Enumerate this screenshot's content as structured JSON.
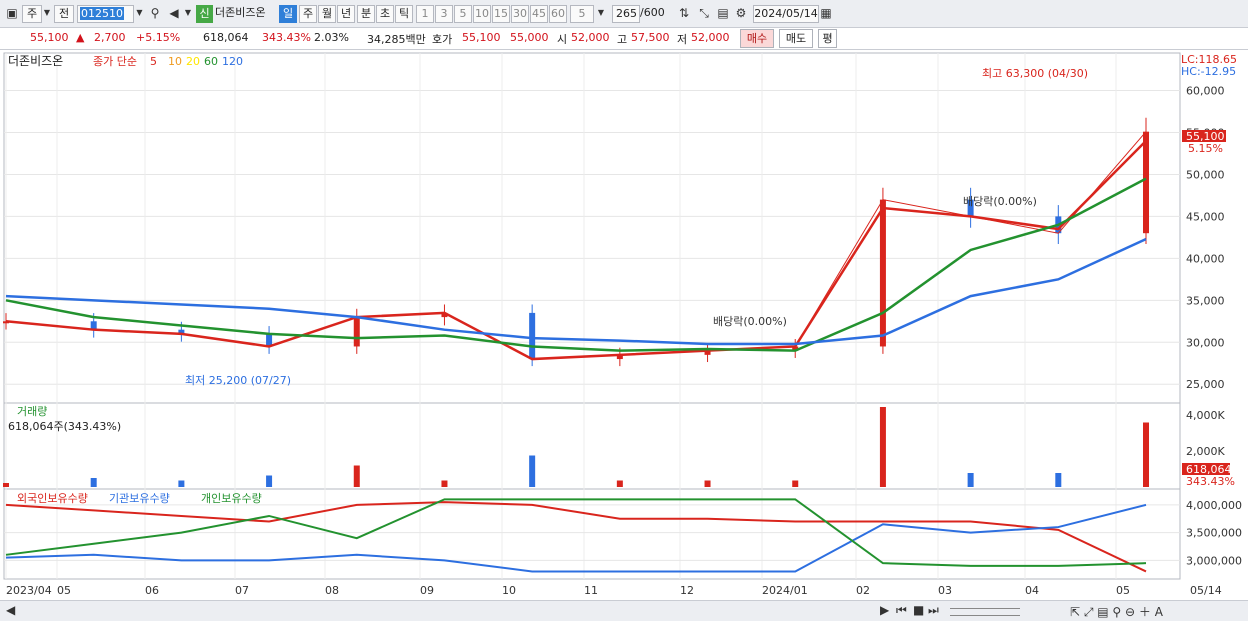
{
  "toolbar": {
    "market": "주",
    "prev": "전",
    "code": "012510",
    "stock_name": "더존비즈온",
    "period_tabs": [
      "일",
      "주",
      "월",
      "년",
      "분",
      "초",
      "틱"
    ],
    "intervals": [
      "1",
      "3",
      "5",
      "10",
      "15",
      "30",
      "45",
      "60"
    ],
    "interval_value": "5",
    "count": "265",
    "count_total": "/600",
    "date": "2024/05/14",
    "prefix_badge": "신"
  },
  "quote": {
    "price": "55,100",
    "change": "2,700",
    "change_pct": "+5.15%",
    "volume": "618,064",
    "vol_ratio": "343.43%",
    "turnover": "2.03%",
    "amount": "34,285백만",
    "bid_label": "호가",
    "ask": "55,100",
    "bid": "55,000",
    "open_label": "시",
    "open": "52,000",
    "high_label": "고",
    "high": "57,500",
    "low_label": "저",
    "low": "52,000",
    "buy": "매수",
    "sell": "매도",
    "eval": "평"
  },
  "price_panel": {
    "name": "더존비즈온",
    "ma_label": "종가 단순",
    "ma_periods": [
      "5",
      "10",
      "20",
      "60",
      "120"
    ],
    "ma_colors": [
      "#d9251d",
      "#ef9a1f",
      "#ffe600",
      "#23922f",
      "#2d6fe0"
    ],
    "lc": "LC:118.65",
    "hc": "HC:-12.95",
    "y_ticks": [
      "60,000",
      "55,000",
      "50,000",
      "45,000",
      "40,000",
      "35,000",
      "30,000",
      "25,000"
    ],
    "last_price": "55,100",
    "last_pct": "5.15%",
    "annot_high": "최고 63,300 (04/30)",
    "annot_low": "최저 25,200 (07/27)",
    "annot_div1": "배당락(0.00%)",
    "annot_div2": "배당락(0.00%)"
  },
  "volume_panel": {
    "title": "거래량",
    "value": "618,064주(343.43%)",
    "y_ticks": [
      "4,000K",
      "2,000K"
    ],
    "last": "618,064",
    "last_pct": "343.43%"
  },
  "holding_panel": {
    "legend": [
      "외국인보유수량",
      "기관보유수량",
      "개인보유수량"
    ],
    "colors": [
      "#d9251d",
      "#2d6fe0",
      "#23922f"
    ],
    "y_ticks": [
      "4,000,000",
      "3,500,000",
      "3,000,000"
    ]
  },
  "x_axis": [
    "2023/04",
    "05",
    "06",
    "07",
    "08",
    "09",
    "10",
    "11",
    "12",
    "2024/01",
    "02",
    "03",
    "04",
    "05",
    "05/14"
  ],
  "chart_data": {
    "type": "line",
    "title": "더존비즈온",
    "x": [
      "2023/04",
      "05",
      "06",
      "07",
      "08",
      "09",
      "10",
      "11",
      "12",
      "2024/01",
      "02",
      "03",
      "04",
      "05"
    ],
    "series": [
      {
        "name": "종가",
        "values": [
          32500,
          31500,
          31000,
          29500,
          33000,
          33500,
          28000,
          28500,
          29000,
          29500,
          47000,
          45000,
          43000,
          55100
        ]
      },
      {
        "name": "5",
        "values": [
          32500,
          31500,
          31000,
          29500,
          33000,
          33500,
          28000,
          28500,
          29000,
          29500,
          46000,
          45000,
          43500,
          54000
        ]
      },
      {
        "name": "60",
        "values": [
          35000,
          33000,
          32000,
          31000,
          30500,
          30800,
          29500,
          29000,
          29200,
          29000,
          33500,
          41000,
          44000,
          49500
        ]
      },
      {
        "name": "120",
        "values": [
          35500,
          35000,
          34500,
          34000,
          33000,
          31500,
          30500,
          30200,
          29800,
          29800,
          30800,
          35500,
          37500,
          42300
        ]
      }
    ],
    "holding_series": [
      {
        "name": "외국인보유수량",
        "values": [
          4000000,
          3900000,
          3800000,
          3700000,
          4000000,
          4050000,
          4000000,
          3750000,
          3750000,
          3700000,
          3700000,
          3700000,
          3550000,
          2800000
        ]
      },
      {
        "name": "기관보유수량",
        "values": [
          3050000,
          3100000,
          3000000,
          3000000,
          3100000,
          3000000,
          2800000,
          2800000,
          2800000,
          2800000,
          3650000,
          3500000,
          3600000,
          4000000
        ]
      },
      {
        "name": "개인보유수량",
        "values": [
          3100000,
          3300000,
          3500000,
          3800000,
          3400000,
          4100000,
          4100000,
          4100000,
          4100000,
          4100000,
          2950000,
          2900000,
          2900000,
          2950000
        ]
      }
    ],
    "ylim": [
      23000,
      64000
    ],
    "legend": "top-left"
  }
}
